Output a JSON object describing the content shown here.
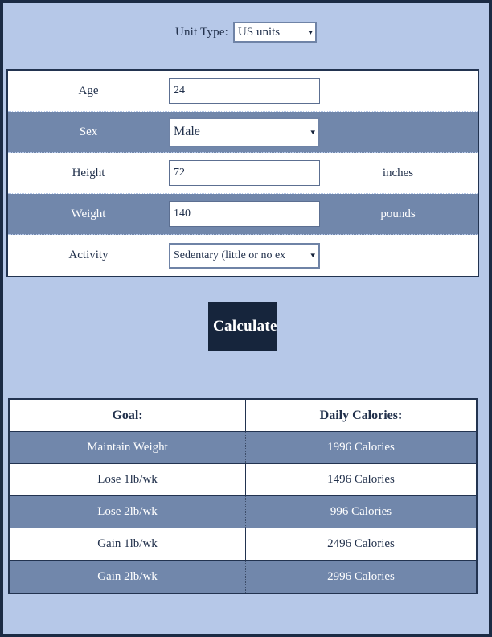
{
  "unit": {
    "label": "Unit Type:",
    "selected": "US units",
    "arrow": "▾"
  },
  "form": {
    "rows": [
      {
        "name": "Age",
        "control": "text",
        "value": "24",
        "unit": ""
      },
      {
        "name": "Sex",
        "control": "select",
        "value": "Male",
        "unit": ""
      },
      {
        "name": "Height",
        "control": "text",
        "value": "72",
        "unit": "inches"
      },
      {
        "name": "Weight",
        "control": "text",
        "value": "140",
        "unit": "pounds"
      },
      {
        "name": "Activity",
        "control": "select",
        "value": "Sedentary (little or no ex",
        "unit": ""
      }
    ]
  },
  "calculate": {
    "label": "Calculate"
  },
  "results": {
    "headers": [
      "Goal:",
      "Daily Calories:"
    ],
    "rows": [
      {
        "goal": "Maintain Weight",
        "calories": "1996 Calories"
      },
      {
        "goal": "Lose 1lb/wk",
        "calories": "1496 Calories"
      },
      {
        "goal": "Lose 2lb/wk",
        "calories": "996 Calories"
      },
      {
        "goal": "Gain 1lb/wk",
        "calories": "2496 Calories"
      },
      {
        "goal": "Gain 2lb/wk",
        "calories": "2996 Calories"
      }
    ]
  },
  "colors": {
    "page_background": "#b6c8e8",
    "page_border": "#1b2b44",
    "row_alt": "#7187ab",
    "row_base": "#ffffff",
    "text": "#22314c",
    "button_background": "#16253c",
    "button_text": "#ffffff"
  }
}
